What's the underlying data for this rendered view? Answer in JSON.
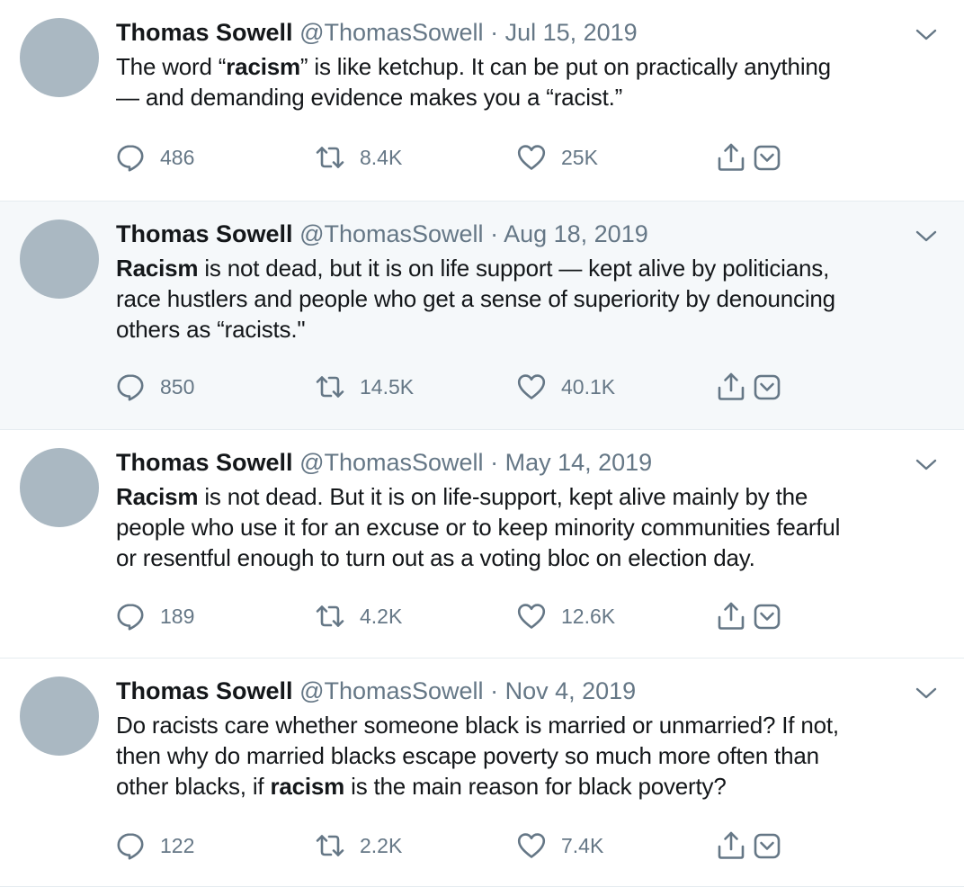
{
  "tweets": [
    {
      "name": "Thomas Sowell",
      "handle": "@ThomasSowell",
      "separator": "·",
      "date": "Jul 15, 2019",
      "text_segments": [
        {
          "t": "The word “",
          "bold": false
        },
        {
          "t": "racism",
          "bold": true
        },
        {
          "t": "” is like ketchup. It can be put on practically anything\n— and demanding evidence makes you a “racist.”",
          "bold": false
        }
      ],
      "replies": "486",
      "retweets": "8.4K",
      "likes": "25K",
      "highlighted": false
    },
    {
      "name": "Thomas Sowell",
      "handle": "@ThomasSowell",
      "separator": "·",
      "date": "Aug 18, 2019",
      "text_segments": [
        {
          "t": "Racism",
          "bold": true
        },
        {
          "t": " is not dead, but it is on life support — kept alive by politicians,\nrace hustlers and people who get a sense of superiority by denouncing\nothers as “racists.\"",
          "bold": false
        }
      ],
      "replies": "850",
      "retweets": "14.5K",
      "likes": "40.1K",
      "highlighted": true
    },
    {
      "name": "Thomas Sowell",
      "handle": "@ThomasSowell",
      "separator": "·",
      "date": "May 14, 2019",
      "text_segments": [
        {
          "t": "Racism",
          "bold": true
        },
        {
          "t": " is not dead. But it is on life-support, kept alive mainly by the\npeople who use it for an excuse or to keep minority communities fearful\nor resentful enough to turn out as a voting bloc on election day.",
          "bold": false
        }
      ],
      "replies": "189",
      "retweets": "4.2K",
      "likes": "12.6K",
      "highlighted": false
    },
    {
      "name": "Thomas Sowell",
      "handle": "@ThomasSowell",
      "separator": "·",
      "date": "Nov 4, 2019",
      "text_segments": [
        {
          "t": "Do racists care whether someone black is married or unmarried? If not,\nthen why do married blacks escape poverty so much more often than\nother blacks, if ",
          "bold": false
        },
        {
          "t": "racism",
          "bold": true
        },
        {
          "t": " is the main reason for black poverty?",
          "bold": false
        }
      ],
      "replies": "122",
      "retweets": "2.2K",
      "likes": "7.4K",
      "highlighted": false
    }
  ],
  "icons": {
    "reply": "reply-icon",
    "retweet": "retweet-icon",
    "like": "heart-icon",
    "share": "share-icon",
    "more": "caret-down-icon",
    "menu": "chevron-down-icon"
  },
  "colors": {
    "icon": "#657786",
    "highlight_bg": "#f5f8fa",
    "avatar": "#aab8c2",
    "divider": "#e6ecf0"
  }
}
